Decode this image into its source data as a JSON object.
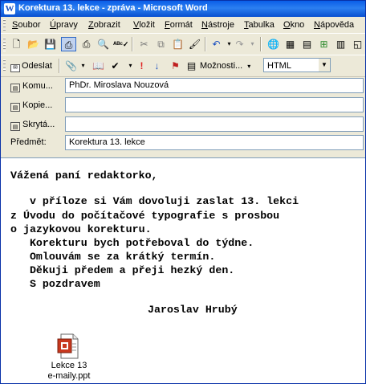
{
  "window": {
    "title": "Korektura 13. lekce - zpráva - Microsoft Word",
    "app_icon": "W"
  },
  "menu": [
    {
      "label": "Soubor",
      "u": "S"
    },
    {
      "label": "Úpravy",
      "u": "Ú"
    },
    {
      "label": "Zobrazit",
      "u": "Z"
    },
    {
      "label": "Vložit",
      "u": "V"
    },
    {
      "label": "Formát",
      "u": "F"
    },
    {
      "label": "Nástroje",
      "u": "N"
    },
    {
      "label": "Tabulka",
      "u": "T"
    },
    {
      "label": "Okno",
      "u": "O"
    },
    {
      "label": "Nápověda",
      "u": "N"
    }
  ],
  "toolbar2": {
    "send_label": "Odeslat",
    "options_label": "Možnosti...",
    "format_value": "HTML"
  },
  "fields": {
    "to_label": "Komu...",
    "to_value": "PhDr. Miroslava Nouzová",
    "cc_label": "Kopie...",
    "cc_value": "",
    "bcc_label": "Skrytá...",
    "bcc_value": "",
    "subject_label": "Předmět:",
    "subject_value": "Korektura 13. lekce"
  },
  "message": {
    "greeting": "Vážená paní redaktorko,",
    "line1": "   v příloze si Vám dovoluji zaslat 13. lekci",
    "line2": "z Úvodu do počítačové typografie s prosbou",
    "line3": "o jazykovou korekturu.",
    "line4": "   Korekturu bych potřeboval do týdne.",
    "line5": "   Omlouvám se za krátký termín.",
    "line6": "   Děkuji předem a přeji hezký den.",
    "line7": "   S pozdravem",
    "signature": "Jaroslav Hrubý"
  },
  "attachment": {
    "name_line1": "Lekce 13",
    "name_line2": "e-maily.ppt",
    "icon": "powerpoint-file-icon"
  },
  "colors": {
    "titlebar": "#0a5ee8",
    "chrome": "#ece9d8",
    "input_border": "#7f9db9"
  }
}
